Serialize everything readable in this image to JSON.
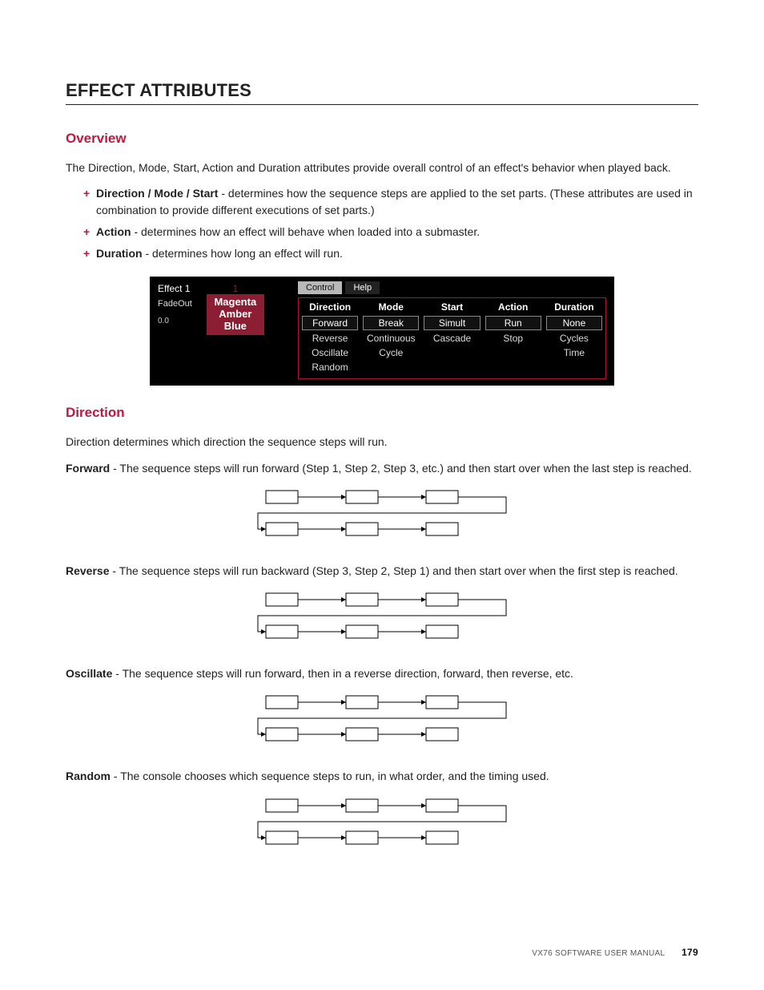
{
  "title": "EFFECT ATTRIBUTES",
  "sections": {
    "overview": {
      "heading": "Overview",
      "intro": "The Direction, Mode, Start, Action and Duration attributes provide overall control of an effect's behavior when played back.",
      "bullets": [
        {
          "term": "Direction / Mode / Start",
          "desc": " - determines how the sequence steps are applied to the set parts. (These attributes are used in combination to provide different executions of set parts.)"
        },
        {
          "term": "Action",
          "desc": " - determines how an effect will behave when loaded into a submaster."
        },
        {
          "term": "Duration",
          "desc": " - determines how long an effect will run."
        }
      ]
    },
    "direction": {
      "heading": "Direction",
      "intro": "Direction determines which direction the sequence steps will run.",
      "terms": [
        {
          "name": "Forward",
          "dash": " - ",
          "desc": "The sequence steps will run forward (Step 1, Step 2, Step 3, etc.) and then start over when the last step is reached."
        },
        {
          "name": "Reverse",
          "dash": " - ",
          "desc": "The sequence steps will run backward (Step 3, Step 2, Step 1) and then start over when the first step is reached."
        },
        {
          "name": "Oscillate",
          "dash": " - ",
          "desc": "The sequence steps will run forward, then in a reverse direction, forward, then reverse, etc."
        },
        {
          "name": "Random",
          "dash": " - ",
          "desc": "The console chooses which sequence steps to run, in what order, and the timing used."
        }
      ]
    }
  },
  "fx_panel": {
    "effect_label": "Effect 1",
    "chip_number": "1",
    "chip_lines": [
      "Magenta",
      "Amber",
      "Blue"
    ],
    "fadeout_label": "FadeOut",
    "fadeout_value": "0.0",
    "tabs": {
      "active": "Control",
      "inactive": "Help"
    },
    "columns": [
      {
        "header": "Direction",
        "selected": "Forward",
        "others": [
          "Reverse",
          "Oscillate",
          "Random"
        ]
      },
      {
        "header": "Mode",
        "selected": "Break",
        "others": [
          "Continuous",
          "Cycle"
        ]
      },
      {
        "header": "Start",
        "selected": "Simult",
        "others": [
          "Cascade"
        ]
      },
      {
        "header": "Action",
        "selected": "Run",
        "others": [
          "Stop"
        ]
      },
      {
        "header": "Duration",
        "selected": "None",
        "others": [
          "Cycles",
          "Time"
        ]
      }
    ]
  },
  "footer": {
    "manual": "VX76 SOFTWARE USER MANUAL",
    "page": "179"
  }
}
